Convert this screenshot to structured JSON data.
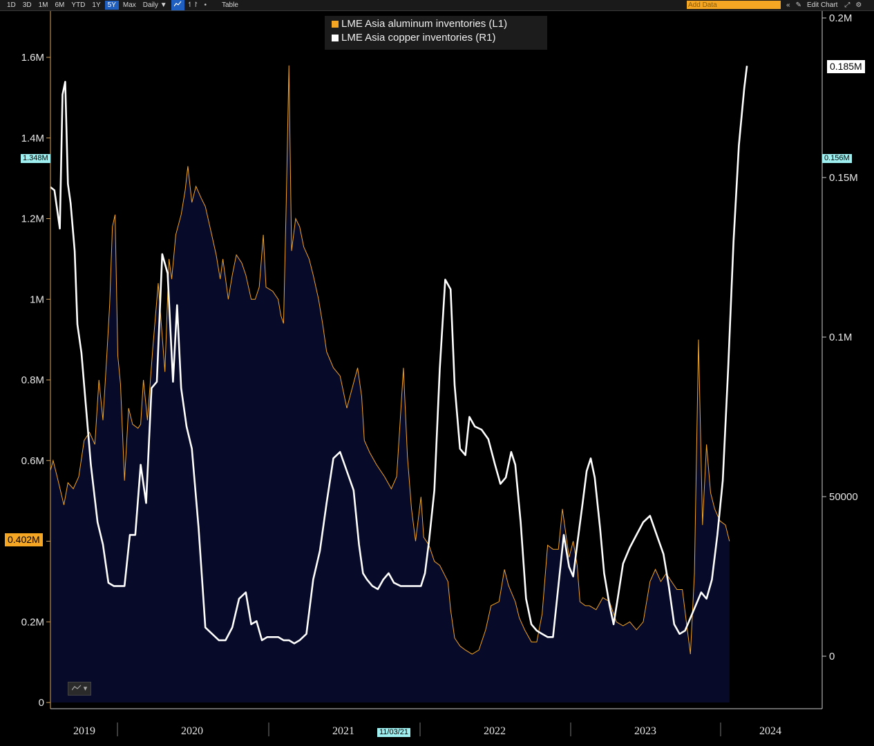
{
  "toolbar": {
    "ranges": [
      "1D",
      "3D",
      "1M",
      "6M",
      "YTD",
      "1Y",
      "5Y",
      "Max"
    ],
    "active_range": "5Y",
    "frequency": "Daily ▼",
    "table_label": "Table",
    "add_data_placeholder": "Add Data",
    "edit_chart_label": "Edit Chart",
    "icons": [
      "line-chart-icon",
      "compare-icon",
      "more-icon",
      "collapse-icon",
      "pencil-icon",
      "gear-icon"
    ]
  },
  "legend": {
    "items": [
      {
        "label": "LME Asia aluminum inventories (L1)",
        "color": "#f5a623"
      },
      {
        "label": "LME Asia copper inventories (R1)",
        "color": "#ffffff"
      }
    ]
  },
  "tags": {
    "left_high": "1.348M",
    "left_last": "0.402M",
    "right_high": "0.156M",
    "right_last": "0.185M",
    "crosshair_date": "11/03/21"
  },
  "colors": {
    "aluminum_line": "#f5a623",
    "area_top": "#08606e",
    "area_bottom": "#070a28",
    "copper_line": "#ffffff",
    "axis": "#d9a35a",
    "background": "#000000"
  },
  "chart_data": {
    "type": "line",
    "x_unit": "year (fractional)",
    "x_range": [
      2018.95,
      2024.55
    ],
    "years": [
      "2019",
      "2020",
      "2021",
      "2022",
      "2023",
      "2024"
    ],
    "left_axis": {
      "ticks": [
        "0",
        "0.2M",
        "0.4M",
        "0.6M",
        "0.8M",
        "1M",
        "1.2M",
        "1.4M",
        "1.6M"
      ],
      "range": [
        0,
        1700000
      ]
    },
    "right_axis": {
      "ticks": [
        "0",
        "50000",
        "0.1M",
        "0.15M",
        "0.2M"
      ],
      "range": [
        -15000,
        200000
      ]
    },
    "series": [
      {
        "name": "LME Asia aluminum inventories (L1)",
        "axis": "left",
        "style": "area",
        "points": [
          [
            2018.95,
            575000
          ],
          [
            2018.97,
            600000
          ],
          [
            2019.0,
            560000
          ],
          [
            2019.05,
            490000
          ],
          [
            2019.08,
            545000
          ],
          [
            2019.12,
            530000
          ],
          [
            2019.16,
            560000
          ],
          [
            2019.2,
            650000
          ],
          [
            2019.24,
            670000
          ],
          [
            2019.28,
            640000
          ],
          [
            2019.31,
            800000
          ],
          [
            2019.34,
            700000
          ],
          [
            2019.37,
            870000
          ],
          [
            2019.39,
            990000
          ],
          [
            2019.41,
            1180000
          ],
          [
            2019.43,
            1210000
          ],
          [
            2019.45,
            860000
          ],
          [
            2019.47,
            790000
          ],
          [
            2019.5,
            550000
          ],
          [
            2019.53,
            730000
          ],
          [
            2019.56,
            690000
          ],
          [
            2019.6,
            680000
          ],
          [
            2019.62,
            690000
          ],
          [
            2019.64,
            800000
          ],
          [
            2019.67,
            700000
          ],
          [
            2019.71,
            880000
          ],
          [
            2019.75,
            1040000
          ],
          [
            2019.8,
            820000
          ],
          [
            2019.83,
            1100000
          ],
          [
            2019.85,
            1050000
          ],
          [
            2019.88,
            1160000
          ],
          [
            2019.92,
            1210000
          ],
          [
            2019.95,
            1270000
          ],
          [
            2019.97,
            1330000
          ],
          [
            2020.0,
            1240000
          ],
          [
            2020.03,
            1280000
          ],
          [
            2020.07,
            1250000
          ],
          [
            2020.1,
            1230000
          ],
          [
            2020.14,
            1170000
          ],
          [
            2020.18,
            1110000
          ],
          [
            2020.21,
            1050000
          ],
          [
            2020.23,
            1100000
          ],
          [
            2020.27,
            1000000
          ],
          [
            2020.3,
            1060000
          ],
          [
            2020.33,
            1110000
          ],
          [
            2020.37,
            1090000
          ],
          [
            2020.4,
            1060000
          ],
          [
            2020.44,
            1000000
          ],
          [
            2020.47,
            1000000
          ],
          [
            2020.5,
            1030000
          ],
          [
            2020.53,
            1160000
          ],
          [
            2020.55,
            1030000
          ],
          [
            2020.6,
            1020000
          ],
          [
            2020.64,
            1000000
          ],
          [
            2020.66,
            960000
          ],
          [
            2020.68,
            940000
          ],
          [
            2020.7,
            1240000
          ],
          [
            2020.72,
            1580000
          ],
          [
            2020.74,
            1120000
          ],
          [
            2020.77,
            1200000
          ],
          [
            2020.8,
            1180000
          ],
          [
            2020.83,
            1130000
          ],
          [
            2020.87,
            1100000
          ],
          [
            2020.9,
            1060000
          ],
          [
            2020.94,
            1000000
          ],
          [
            2020.97,
            940000
          ],
          [
            2021.0,
            870000
          ],
          [
            2021.05,
            830000
          ],
          [
            2021.1,
            810000
          ],
          [
            2021.15,
            730000
          ],
          [
            2021.19,
            780000
          ],
          [
            2021.23,
            830000
          ],
          [
            2021.26,
            760000
          ],
          [
            2021.28,
            650000
          ],
          [
            2021.32,
            620000
          ],
          [
            2021.37,
            590000
          ],
          [
            2021.43,
            560000
          ],
          [
            2021.48,
            530000
          ],
          [
            2021.52,
            560000
          ],
          [
            2021.55,
            720000
          ],
          [
            2021.57,
            830000
          ],
          [
            2021.6,
            610000
          ],
          [
            2021.63,
            480000
          ],
          [
            2021.66,
            400000
          ],
          [
            2021.7,
            510000
          ],
          [
            2021.72,
            410000
          ],
          [
            2021.76,
            390000
          ],
          [
            2021.8,
            350000
          ],
          [
            2021.84,
            340000
          ],
          [
            2021.87,
            320000
          ],
          [
            2021.9,
            300000
          ],
          [
            2021.92,
            230000
          ],
          [
            2021.95,
            160000
          ],
          [
            2021.99,
            140000
          ],
          [
            2022.03,
            130000
          ],
          [
            2022.08,
            120000
          ],
          [
            2022.13,
            130000
          ],
          [
            2022.18,
            180000
          ],
          [
            2022.22,
            240000
          ],
          [
            2022.28,
            250000
          ],
          [
            2022.32,
            330000
          ],
          [
            2022.35,
            290000
          ],
          [
            2022.4,
            250000
          ],
          [
            2022.43,
            210000
          ],
          [
            2022.47,
            180000
          ],
          [
            2022.52,
            150000
          ],
          [
            2022.56,
            150000
          ],
          [
            2022.6,
            220000
          ],
          [
            2022.64,
            390000
          ],
          [
            2022.68,
            380000
          ],
          [
            2022.72,
            380000
          ],
          [
            2022.75,
            480000
          ],
          [
            2022.8,
            360000
          ],
          [
            2022.83,
            400000
          ],
          [
            2022.86,
            340000
          ],
          [
            2022.88,
            250000
          ],
          [
            2022.92,
            240000
          ],
          [
            2022.95,
            240000
          ],
          [
            2023.0,
            230000
          ],
          [
            2023.05,
            260000
          ],
          [
            2023.1,
            250000
          ],
          [
            2023.15,
            200000
          ],
          [
            2023.2,
            190000
          ],
          [
            2023.25,
            200000
          ],
          [
            2023.3,
            180000
          ],
          [
            2023.35,
            200000
          ],
          [
            2023.4,
            300000
          ],
          [
            2023.44,
            330000
          ],
          [
            2023.48,
            300000
          ],
          [
            2023.52,
            320000
          ],
          [
            2023.56,
            300000
          ],
          [
            2023.6,
            280000
          ],
          [
            2023.64,
            280000
          ],
          [
            2023.67,
            200000
          ],
          [
            2023.7,
            120000
          ],
          [
            2023.73,
            320000
          ],
          [
            2023.76,
            900000
          ],
          [
            2023.79,
            440000
          ],
          [
            2023.82,
            640000
          ],
          [
            2023.85,
            520000
          ],
          [
            2023.88,
            480000
          ],
          [
            2023.92,
            450000
          ],
          [
            2023.96,
            440000
          ],
          [
            2023.99,
            400000
          ]
        ]
      },
      {
        "name": "LME Asia copper inventories (R1)",
        "axis": "right",
        "style": "line",
        "points": [
          [
            2018.95,
            147000
          ],
          [
            2018.98,
            146000
          ],
          [
            2019.0,
            140000
          ],
          [
            2019.02,
            134000
          ],
          [
            2019.04,
            176000
          ],
          [
            2019.06,
            180000
          ],
          [
            2019.08,
            148000
          ],
          [
            2019.1,
            142000
          ],
          [
            2019.13,
            127000
          ],
          [
            2019.15,
            104000
          ],
          [
            2019.18,
            95000
          ],
          [
            2019.21,
            80000
          ],
          [
            2019.25,
            60000
          ],
          [
            2019.3,
            42000
          ],
          [
            2019.34,
            35000
          ],
          [
            2019.38,
            23000
          ],
          [
            2019.42,
            22000
          ],
          [
            2019.46,
            22000
          ],
          [
            2019.5,
            22000
          ],
          [
            2019.54,
            38000
          ],
          [
            2019.58,
            38000
          ],
          [
            2019.62,
            60000
          ],
          [
            2019.66,
            48000
          ],
          [
            2019.7,
            84000
          ],
          [
            2019.74,
            86000
          ],
          [
            2019.78,
            126000
          ],
          [
            2019.82,
            120000
          ],
          [
            2019.86,
            86000
          ],
          [
            2019.89,
            110000
          ],
          [
            2019.92,
            84000
          ],
          [
            2019.96,
            72000
          ],
          [
            2020.0,
            65000
          ],
          [
            2020.05,
            40000
          ],
          [
            2020.1,
            9000
          ],
          [
            2020.15,
            7000
          ],
          [
            2020.2,
            5000
          ],
          [
            2020.25,
            5000
          ],
          [
            2020.3,
            9000
          ],
          [
            2020.35,
            18000
          ],
          [
            2020.4,
            20000
          ],
          [
            2020.44,
            10000
          ],
          [
            2020.48,
            11000
          ],
          [
            2020.52,
            5000
          ],
          [
            2020.56,
            6000
          ],
          [
            2020.6,
            6000
          ],
          [
            2020.64,
            6000
          ],
          [
            2020.68,
            5000
          ],
          [
            2020.72,
            5000
          ],
          [
            2020.76,
            4000
          ],
          [
            2020.8,
            5000
          ],
          [
            2020.85,
            7000
          ],
          [
            2020.9,
            24000
          ],
          [
            2020.95,
            33000
          ],
          [
            2021.0,
            48000
          ],
          [
            2021.05,
            62000
          ],
          [
            2021.1,
            64000
          ],
          [
            2021.15,
            58000
          ],
          [
            2021.2,
            52000
          ],
          [
            2021.24,
            35000
          ],
          [
            2021.27,
            26000
          ],
          [
            2021.3,
            24000
          ],
          [
            2021.34,
            22000
          ],
          [
            2021.38,
            21000
          ],
          [
            2021.42,
            24000
          ],
          [
            2021.46,
            26000
          ],
          [
            2021.5,
            23000
          ],
          [
            2021.55,
            22000
          ],
          [
            2021.6,
            22000
          ],
          [
            2021.65,
            22000
          ],
          [
            2021.7,
            22000
          ],
          [
            2021.73,
            26000
          ],
          [
            2021.76,
            36000
          ],
          [
            2021.8,
            52000
          ],
          [
            2021.84,
            90000
          ],
          [
            2021.88,
            118000
          ],
          [
            2021.92,
            115000
          ],
          [
            2021.95,
            85000
          ],
          [
            2021.99,
            65000
          ],
          [
            2022.03,
            63000
          ],
          [
            2022.06,
            75000
          ],
          [
            2022.1,
            72000
          ],
          [
            2022.15,
            71000
          ],
          [
            2022.2,
            68000
          ],
          [
            2022.25,
            60000
          ],
          [
            2022.29,
            54000
          ],
          [
            2022.33,
            56000
          ],
          [
            2022.37,
            64000
          ],
          [
            2022.4,
            60000
          ],
          [
            2022.44,
            42000
          ],
          [
            2022.48,
            18000
          ],
          [
            2022.52,
            10000
          ],
          [
            2022.56,
            8000
          ],
          [
            2022.6,
            7000
          ],
          [
            2022.64,
            6000
          ],
          [
            2022.68,
            6000
          ],
          [
            2022.72,
            22000
          ],
          [
            2022.76,
            38000
          ],
          [
            2022.8,
            28000
          ],
          [
            2022.83,
            25000
          ],
          [
            2022.86,
            35000
          ],
          [
            2022.9,
            48000
          ],
          [
            2022.93,
            58000
          ],
          [
            2022.96,
            62000
          ],
          [
            2022.99,
            56000
          ],
          [
            2023.03,
            40000
          ],
          [
            2023.06,
            26000
          ],
          [
            2023.1,
            16000
          ],
          [
            2023.13,
            10000
          ],
          [
            2023.16,
            18000
          ],
          [
            2023.2,
            29000
          ],
          [
            2023.25,
            34000
          ],
          [
            2023.3,
            38000
          ],
          [
            2023.35,
            42000
          ],
          [
            2023.4,
            44000
          ],
          [
            2023.45,
            38000
          ],
          [
            2023.5,
            32000
          ],
          [
            2023.54,
            22000
          ],
          [
            2023.58,
            10000
          ],
          [
            2023.62,
            7000
          ],
          [
            2023.66,
            8000
          ],
          [
            2023.7,
            12000
          ],
          [
            2023.74,
            16000
          ],
          [
            2023.78,
            20000
          ],
          [
            2023.82,
            18000
          ],
          [
            2023.86,
            24000
          ],
          [
            2023.9,
            38000
          ],
          [
            2023.94,
            55000
          ],
          [
            2023.98,
            90000
          ],
          [
            2024.02,
            130000
          ],
          [
            2024.06,
            160000
          ],
          [
            2024.1,
            178000
          ],
          [
            2024.12,
            185000
          ]
        ]
      }
    ]
  }
}
